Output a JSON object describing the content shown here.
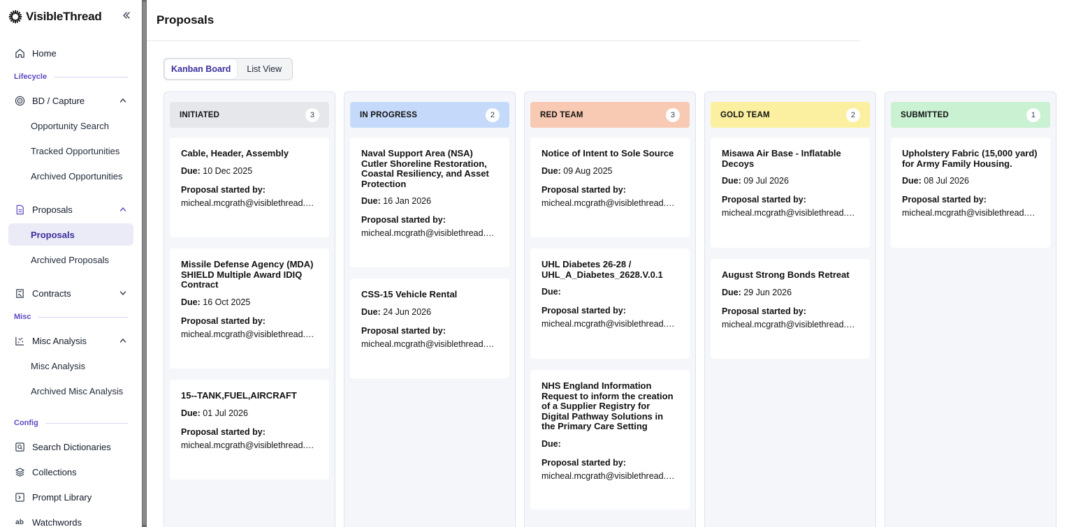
{
  "app": {
    "name": "VisibleThread"
  },
  "sidebar": {
    "collapse_icon": "double-chevron-left-icon",
    "home": {
      "label": "Home",
      "icon": "home-icon"
    },
    "sections": {
      "lifecycle": "Lifecycle",
      "misc": "Misc",
      "config": "Config"
    },
    "bd_capture": {
      "label": "BD / Capture",
      "icon": "target-icon",
      "items": [
        "Opportunity Search",
        "Tracked Opportunities",
        "Archived Opportunities"
      ]
    },
    "proposals": {
      "label": "Proposals",
      "icon": "document-icon",
      "items": [
        "Proposals",
        "Archived Proposals"
      ]
    },
    "contracts": {
      "label": "Contracts",
      "icon": "contract-icon"
    },
    "misc_analysis": {
      "label": "Misc Analysis",
      "icon": "scatter-chart-icon",
      "items": [
        "Misc Analysis",
        "Archived Misc Analysis"
      ]
    },
    "config_items": [
      {
        "label": "Search Dictionaries",
        "icon": "dictionary-icon"
      },
      {
        "label": "Collections",
        "icon": "layers-icon"
      },
      {
        "label": "Prompt Library",
        "icon": "prompt-icon"
      },
      {
        "label": "Watchwords",
        "icon": "ab-text-icon"
      }
    ]
  },
  "page": {
    "title": "Proposals"
  },
  "view_toggle": {
    "kanban": "Kanban Board",
    "list": "List View",
    "selected": "Kanban Board"
  },
  "board": {
    "due_label": "Due:",
    "started_label": "Proposal started by:",
    "columns": [
      {
        "title": "INITIATED",
        "count": "3",
        "color": "#e5e7eb",
        "cards": [
          {
            "title": "Cable, Header, Assembly",
            "due": "10 Dec 2025",
            "email": "micheal.mcgrath@visiblethread.com"
          },
          {
            "title": "Missile Defense Agency (MDA) SHIELD Multiple Award IDIQ Contract",
            "due": "16 Oct 2025",
            "email": "micheal.mcgrath@visiblethread.com"
          },
          {
            "title": "15--TANK,FUEL,AIRCRAFT",
            "due": "01 Jul 2026",
            "email": "micheal.mcgrath@visiblethread.com"
          }
        ]
      },
      {
        "title": "IN PROGRESS",
        "count": "2",
        "color": "#c5dafa",
        "cards": [
          {
            "title": "Naval Support Area (NSA) Cutler Shoreline Restoration, Coastal Resiliency, and Asset Protection",
            "due": "16 Jan 2026",
            "email": "micheal.mcgrath@visiblethread.com"
          },
          {
            "title": "CSS-15 Vehicle Rental",
            "due": "24 Jun 2026",
            "email": "micheal.mcgrath@visiblethread.com"
          }
        ]
      },
      {
        "title": "RED TEAM",
        "count": "3",
        "color": "#f8c9b3",
        "cards": [
          {
            "title": "Notice of Intent to Sole Source",
            "due": "09 Aug 2025",
            "email": "micheal.mcgrath@visiblethread.com"
          },
          {
            "title": "UHL Diabetes 26-28 / UHL_A_Diabetes_2628.V.0.1",
            "due": "",
            "email": "micheal.mcgrath@visiblethread.com"
          },
          {
            "title": "NHS England Information Request to inform the creation of a Supplier Registry for Digital Pathway Solutions in the Primary Care Setting",
            "due": "",
            "email": "micheal.mcgrath@visiblethread.com"
          }
        ]
      },
      {
        "title": "GOLD TEAM",
        "count": "2",
        "color": "#fbf0a0",
        "cards": [
          {
            "title": "Misawa Air Base - Inflatable Decoys",
            "due": "09 Jul 2026",
            "email": "micheal.mcgrath@visiblethread.com"
          },
          {
            "title": "August Strong Bonds Retreat",
            "due": "29 Jun 2026",
            "email": "micheal.mcgrath@visiblethread.com"
          }
        ]
      },
      {
        "title": "SUBMITTED",
        "count": "1",
        "color": "#c9f1d2",
        "cards": [
          {
            "title": "Upholstery Fabric (15,000 yard) for Army Family Housing.",
            "due": "08 Jul 2026",
            "email": "micheal.mcgrath@visiblethread.com"
          }
        ]
      }
    ]
  }
}
